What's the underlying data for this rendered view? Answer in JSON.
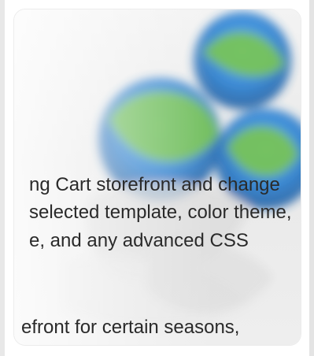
{
  "body_text": {
    "line1": "ng Cart storefront and change",
    "line2": "selected template, color theme,",
    "line3": "e, and any advanced CSS",
    "line4": "efront for certain seasons,"
  },
  "hero_image": {
    "icon": "store-template-icon",
    "colors": {
      "blue": "#2f86d8",
      "green": "#6dbf4e",
      "background": "#f1f1f1"
    }
  }
}
